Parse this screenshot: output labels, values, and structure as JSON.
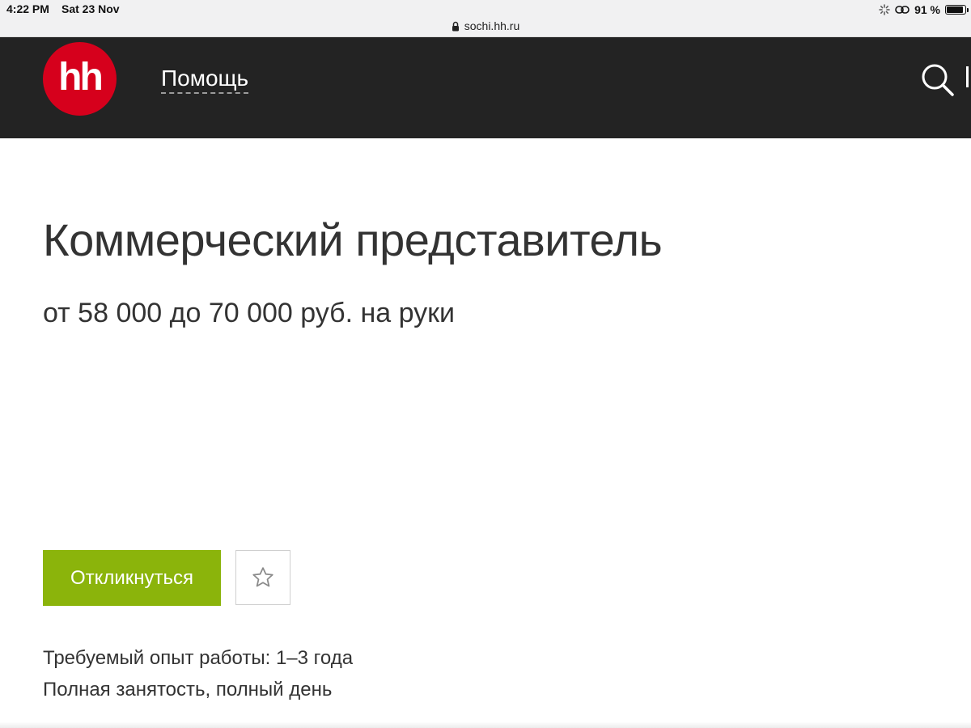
{
  "status_bar": {
    "time": "4:22 PM",
    "date": "Sat 23 Nov",
    "battery_percent": "91 %",
    "battery_level": 0.91
  },
  "browser": {
    "url": "sochi.hh.ru"
  },
  "header": {
    "logo_text": "hh",
    "logo_color": "#d6001c",
    "help_link": "Помощь",
    "background": "#232323"
  },
  "vacancy": {
    "title": "Коммерческий представитель",
    "salary": "от 58 000 до 70 000 руб. на руки",
    "apply_button": "Откликнуться",
    "apply_color": "#8bb40b",
    "experience": "Требуемый опыт работы: 1–3 года",
    "employment": "Полная занятость, полный день"
  },
  "icons": {
    "lock": "lock-icon",
    "search": "search-icon",
    "favorite": "star-icon",
    "wifi": "wifi-icon",
    "link": "link-icon",
    "activity": "activity-icon",
    "battery": "battery-icon"
  }
}
